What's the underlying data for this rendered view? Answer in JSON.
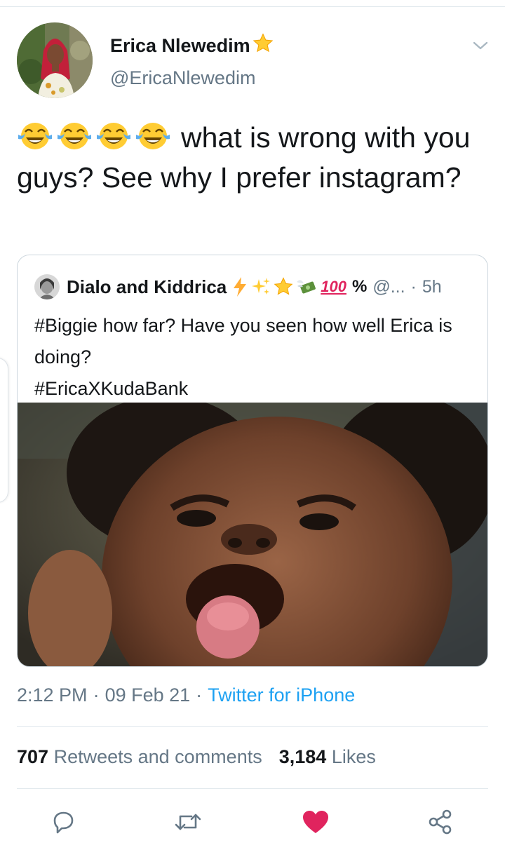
{
  "author": {
    "name": "Erica Nlewedim",
    "handle": "@EricaNlewedim",
    "verified_emoji": "star"
  },
  "tweet": {
    "emojis": [
      "face-with-tears-of-joy",
      "face-with-tears-of-joy",
      "face-with-tears-of-joy",
      "face-with-tears-of-joy"
    ],
    "text": "what is wrong with you guys? See why I prefer instagram?"
  },
  "quoted": {
    "name": "Dialo and Kiddrica",
    "name_emojis": [
      "lightning-icon",
      "sparkles-icon",
      "star-icon",
      "money-with-wings-icon",
      "hundred-points-icon"
    ],
    "hundred": "100",
    "percent": "%",
    "handle": "@...",
    "dot": "·",
    "time": "5h",
    "text_line1": "#Biggie how far? Have you seen how well Erica is doing?",
    "text_line2": "#EricaXKudaBank",
    "image_alt": "baby sticking out tongue"
  },
  "meta": {
    "time": "2:12 PM",
    "sep1": "·",
    "date": "09 Feb 21",
    "sep2": "·",
    "source": "Twitter for iPhone"
  },
  "stats": {
    "retweets_count": "707",
    "retweets_label": "Retweets and comments",
    "likes_count": "3,184",
    "likes_label": "Likes"
  },
  "colors": {
    "link": "#1da1f2",
    "muted": "#657786",
    "like": "#e0245e"
  }
}
